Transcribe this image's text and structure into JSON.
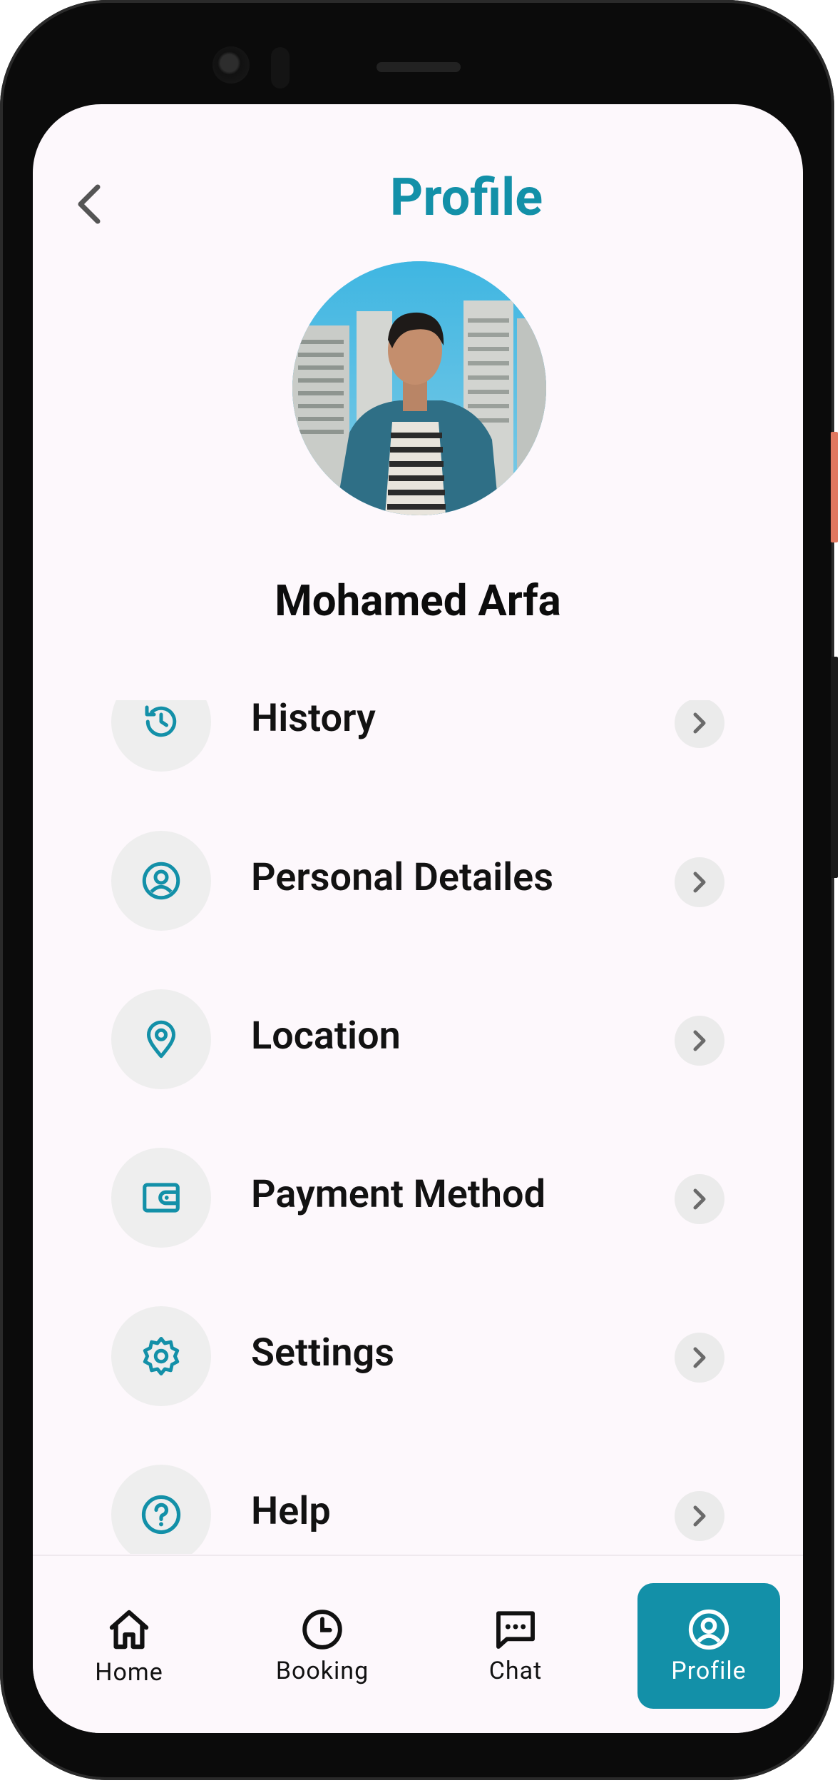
{
  "header": {
    "title": "Profile",
    "back_icon": "chevron-left-icon"
  },
  "profile": {
    "name": "Mohamed Arfa",
    "avatar_icon": "profile-photo"
  },
  "menu": {
    "items": [
      {
        "label": "History",
        "icon": "history-icon"
      },
      {
        "label": "Personal Detailes",
        "icon": "user-circle-icon"
      },
      {
        "label": "Location",
        "icon": "location-pin-icon"
      },
      {
        "label": "Payment Method",
        "icon": "wallet-icon"
      },
      {
        "label": "Settings",
        "icon": "gear-icon"
      },
      {
        "label": "Help",
        "icon": "help-circle-icon"
      }
    ]
  },
  "bottom_nav": {
    "items": [
      {
        "label": "Home",
        "icon": "home-icon",
        "active": false
      },
      {
        "label": "Booking",
        "icon": "clock-icon",
        "active": false
      },
      {
        "label": "Chat",
        "icon": "chat-icon",
        "active": false
      },
      {
        "label": "Profile",
        "icon": "user-circle-icon",
        "active": true
      }
    ]
  },
  "colors": {
    "accent": "#1390a8",
    "background": "#fdf8fc",
    "icon_bg": "#eeeeee"
  }
}
